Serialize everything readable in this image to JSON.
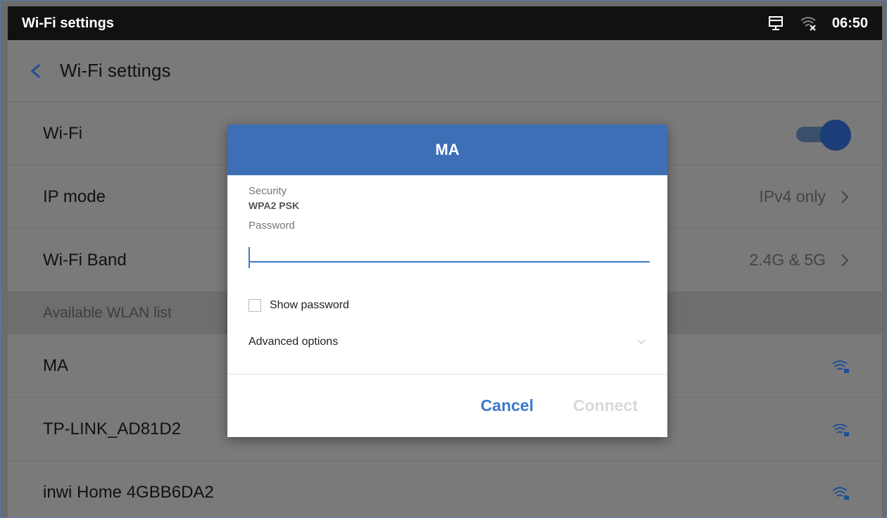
{
  "status_bar": {
    "title": "Wi-Fi settings",
    "time": "06:50",
    "icons": [
      "network-icon",
      "wifi-off-icon"
    ]
  },
  "header": {
    "title": "Wi-Fi settings",
    "back_icon": "back-chevron-icon"
  },
  "settings": {
    "wifi": {
      "label": "Wi-Fi",
      "enabled": true
    },
    "ip_mode": {
      "label": "IP mode",
      "value": "IPv4 only"
    },
    "wifi_band": {
      "label": "Wi-Fi Band",
      "value": "2.4G & 5G"
    },
    "section_label": "Available WLAN list",
    "networks": [
      {
        "name": "MA",
        "icon": "wifi-locked-icon"
      },
      {
        "name": "TP-LINK_AD81D2",
        "icon": "wifi-locked-icon"
      },
      {
        "name": "inwi Home 4GBB6DA2",
        "icon": "wifi-locked-icon"
      }
    ]
  },
  "dialog": {
    "title": "MA",
    "security_label": "Security",
    "security_value": "WPA2 PSK",
    "password_label": "Password",
    "password_value": "",
    "show_password_label": "Show password",
    "show_password_checked": false,
    "advanced_label": "Advanced options",
    "cancel_label": "Cancel",
    "connect_label": "Connect"
  },
  "colors": {
    "accent": "#3d78c8",
    "dialog_header": "#3d6fb6",
    "status_bar": "#111111",
    "dim_background": "#7a7a7a"
  }
}
